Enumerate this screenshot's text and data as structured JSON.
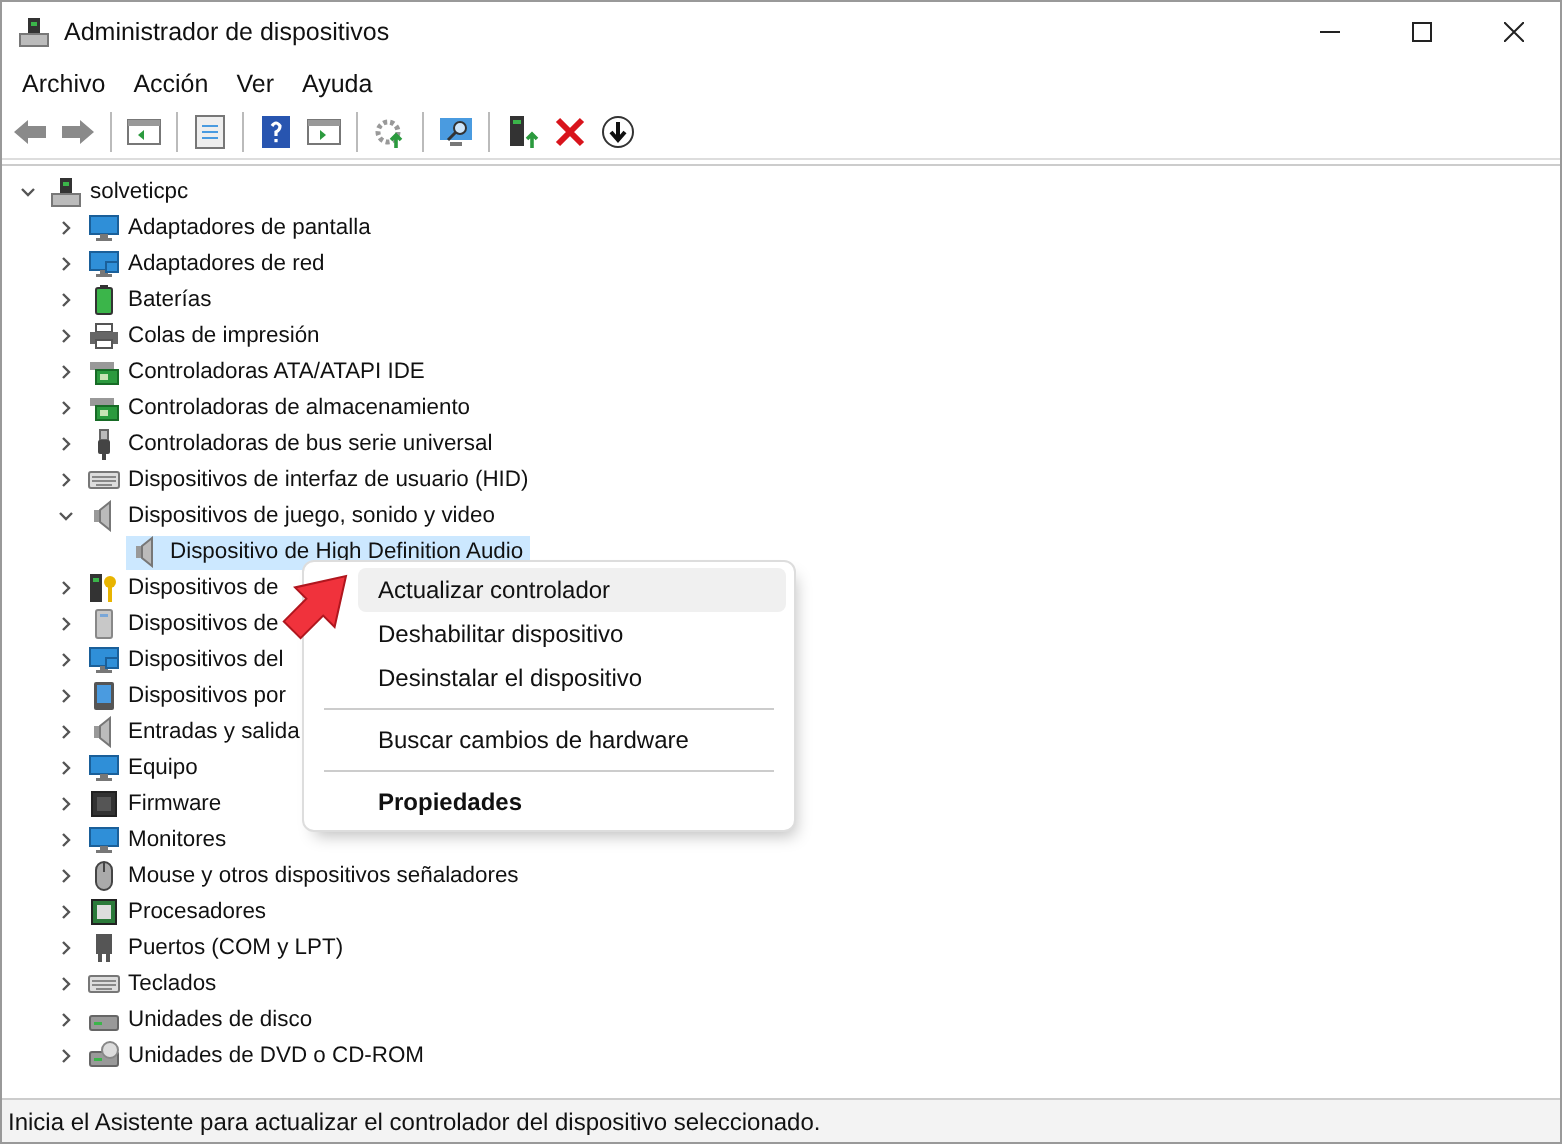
{
  "window": {
    "title": "Administrador de dispositivos"
  },
  "menu_bar": [
    "Archivo",
    "Acción",
    "Ver",
    "Ayuda"
  ],
  "tree": {
    "label": "solveticpc",
    "expanded": true,
    "selected": false,
    "children": [
      {
        "label": "Adaptadores de pantalla",
        "expanded": false,
        "selected": false
      },
      {
        "label": "Adaptadores de red",
        "expanded": false,
        "selected": false
      },
      {
        "label": "Baterías",
        "expanded": false,
        "selected": false
      },
      {
        "label": "Colas de impresión",
        "expanded": false,
        "selected": false
      },
      {
        "label": "Controladoras ATA/ATAPI IDE",
        "expanded": false,
        "selected": false
      },
      {
        "label": "Controladoras de almacenamiento",
        "expanded": false,
        "selected": false
      },
      {
        "label": "Controladoras de bus serie universal",
        "expanded": false,
        "selected": false
      },
      {
        "label": "Dispositivos de interfaz de usuario (HID)",
        "expanded": false,
        "selected": false
      },
      {
        "label": "Dispositivos de juego, sonido y video",
        "expanded": true,
        "selected": false,
        "children": [
          {
            "label": "Dispositivo de High Definition Audio",
            "selected": true
          }
        ]
      },
      {
        "label": "Dispositivos de",
        "expanded": false,
        "selected": false
      },
      {
        "label": "Dispositivos de",
        "expanded": false,
        "selected": false
      },
      {
        "label": "Dispositivos del",
        "expanded": false,
        "selected": false
      },
      {
        "label": "Dispositivos por",
        "expanded": false,
        "selected": false
      },
      {
        "label": "Entradas y salida",
        "expanded": false,
        "selected": false
      },
      {
        "label": "Equipo",
        "expanded": false,
        "selected": false
      },
      {
        "label": "Firmware",
        "expanded": false,
        "selected": false
      },
      {
        "label": "Monitores",
        "expanded": false,
        "selected": false
      },
      {
        "label": "Mouse y otros dispositivos señaladores",
        "expanded": false,
        "selected": false
      },
      {
        "label": "Procesadores",
        "expanded": false,
        "selected": false
      },
      {
        "label": "Puertos (COM y LPT)",
        "expanded": false,
        "selected": false
      },
      {
        "label": "Teclados",
        "expanded": false,
        "selected": false
      },
      {
        "label": "Unidades de disco",
        "expanded": false,
        "selected": false
      },
      {
        "label": "Unidades de DVD o CD-ROM",
        "expanded": false,
        "selected": false
      }
    ]
  },
  "context_menu": [
    {
      "kind": "item",
      "label": "Actualizar controlador",
      "selected": true,
      "default": false
    },
    {
      "kind": "item",
      "label": "Deshabilitar dispositivo",
      "selected": false,
      "default": false
    },
    {
      "kind": "item",
      "label": "Desinstalar el dispositivo",
      "selected": false,
      "default": false
    },
    {
      "kind": "separator"
    },
    {
      "kind": "item",
      "label": "Buscar cambios de hardware",
      "selected": false,
      "default": false
    },
    {
      "kind": "separator"
    },
    {
      "kind": "item",
      "label": "Propiedades",
      "selected": false,
      "default": true
    }
  ],
  "status_bar": "Inicia el Asistente para actualizar el controlador del dispositivo seleccionado."
}
